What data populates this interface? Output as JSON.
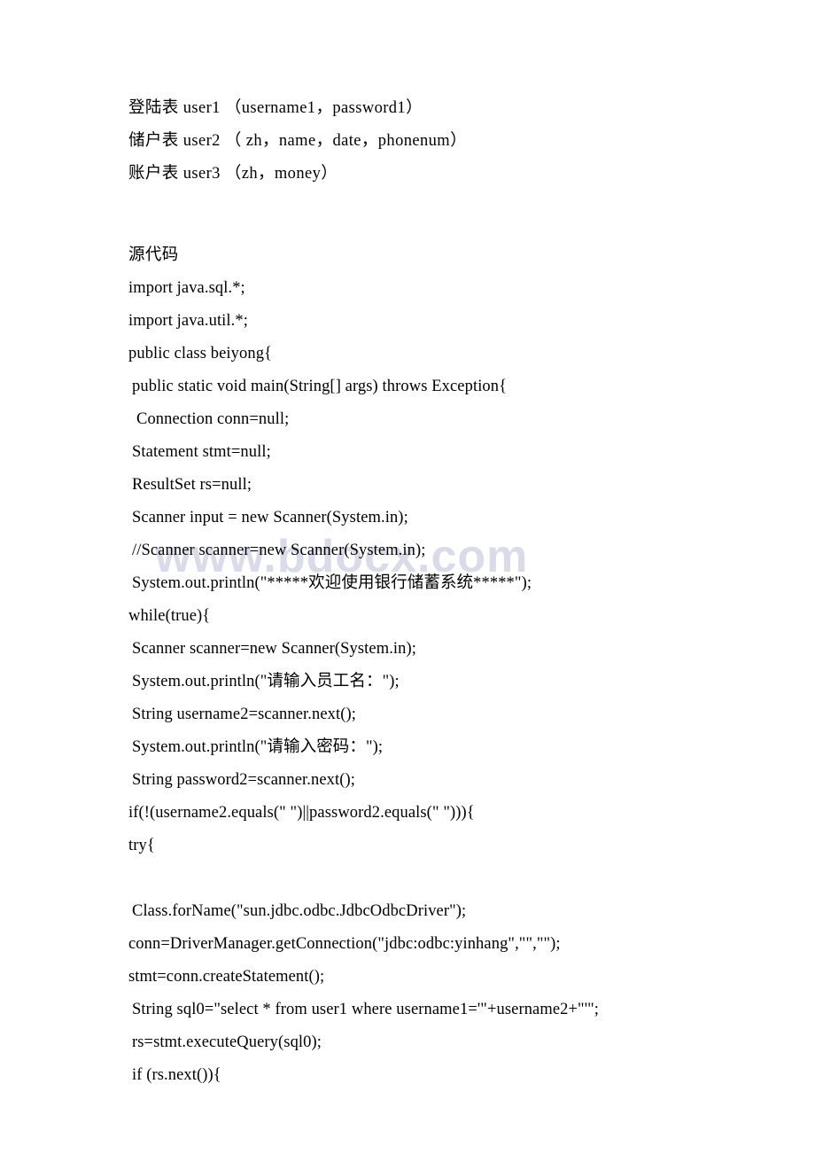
{
  "document": {
    "watermark": "www.bdocx.com",
    "schema_section": {
      "lines": [
        "登陆表 user1 （username1，password1）",
        "储户表 user2 （ zh，name，date，phonenum）",
        "账户表 user3 （zh，money）"
      ]
    },
    "code_section": {
      "heading": "源代码",
      "lines": [
        {
          "text": "import java.sql.*;",
          "indent": 0
        },
        {
          "text": "import java.util.*;",
          "indent": 0
        },
        {
          "text": "public class beiyong{",
          "indent": 0
        },
        {
          "text": "public static void main(String[] args) throws Exception{",
          "indent": 1
        },
        {
          "text": "Connection conn=null;",
          "indent": 2
        },
        {
          "text": "Statement stmt=null;",
          "indent": 1
        },
        {
          "text": "ResultSet rs=null;",
          "indent": 1
        },
        {
          "text": "Scanner input = new Scanner(System.in);",
          "indent": 1
        },
        {
          "text": "//Scanner scanner=new Scanner(System.in);",
          "indent": 1
        },
        {
          "text": "System.out.println(\"*****欢迎使用银行储蓄系统*****\");",
          "indent": 1
        },
        {
          "text": "while(true){",
          "indent": 0
        },
        {
          "text": "Scanner scanner=new Scanner(System.in);",
          "indent": 1
        },
        {
          "text": "System.out.println(\"请输入员工名：\");",
          "indent": 1
        },
        {
          "text": "String username2=scanner.next();",
          "indent": 1
        },
        {
          "text": "System.out.println(\"请输入密码：\");",
          "indent": 1
        },
        {
          "text": "String password2=scanner.next();",
          "indent": 1
        },
        {
          "text": "if(!(username2.equals(\" \")||password2.equals(\" \"))){",
          "indent": 0
        },
        {
          "text": "try{",
          "indent": 0
        },
        {
          "text": "",
          "indent": 0
        },
        {
          "text": "Class.forName(\"sun.jdbc.odbc.JdbcOdbcDriver\");",
          "indent": 1
        },
        {
          "text": "conn=DriverManager.getConnection(\"jdbc:odbc:yinhang\",\"\",\"\");",
          "indent": 0
        },
        {
          "text": "stmt=conn.createStatement();",
          "indent": 0
        },
        {
          "text": "String sql0=\"select * from user1 where username1='\"+username2+\"'\";",
          "indent": 1
        },
        {
          "text": "rs=stmt.executeQuery(sql0);",
          "indent": 1
        },
        {
          "text": "if (rs.next()){",
          "indent": 1
        }
      ]
    }
  }
}
